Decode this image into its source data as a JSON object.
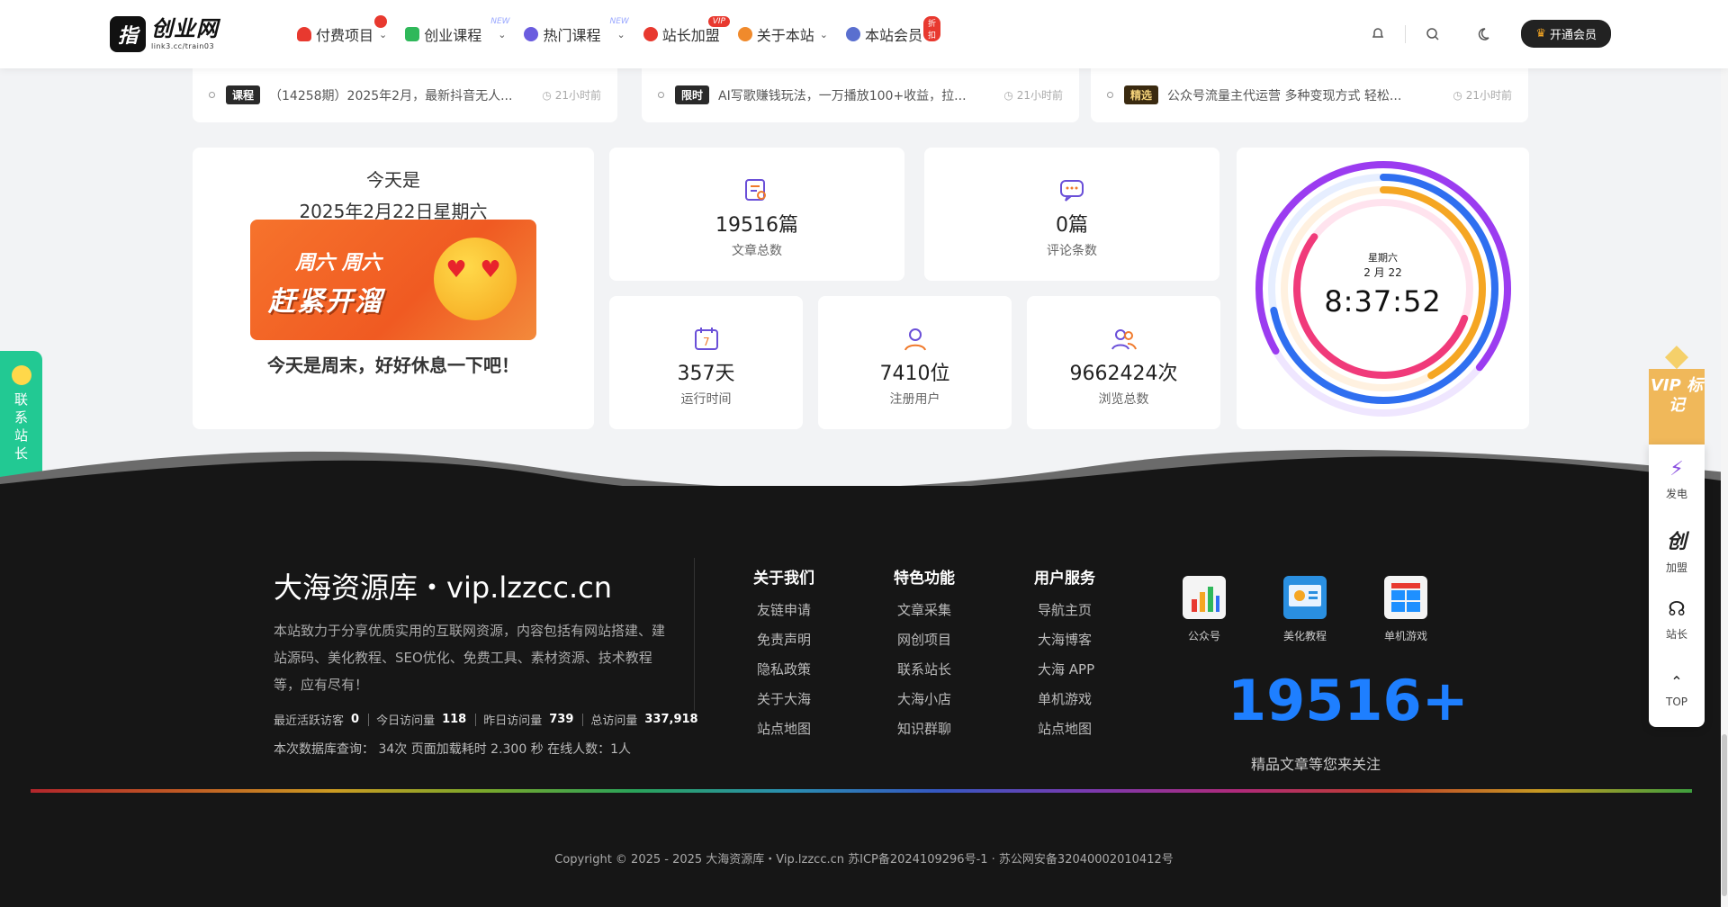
{
  "header": {
    "logo_mark": "指",
    "logo_title": "创业网",
    "logo_sub": "link3.cc/train03",
    "nav": [
      {
        "label": "付费项目",
        "badge": "",
        "color": "#e8392f"
      },
      {
        "label": "创业课程",
        "badge": "NEW",
        "color": "#2fb85a"
      },
      {
        "label": "热门课程",
        "badge": "NEW",
        "color": "#6a5cdf"
      },
      {
        "label": "站长加盟",
        "badge": "VIP",
        "color": "#e8392f"
      },
      {
        "label": "关于本站",
        "badge": "",
        "color": "#f08a2c"
      },
      {
        "label": "本站会员",
        "badge": "折扣",
        "color": "#5a6fcf"
      }
    ],
    "vip_button": "开通会员"
  },
  "lists": [
    {
      "tag": "课程",
      "title": "（14258期）2025年2月，最新抖音无人...",
      "time": "21小时前"
    },
    {
      "tag": "限时",
      "title": "AI写歌赚钱玩法，一万播放100+收益，拉...",
      "time": "21小时前"
    },
    {
      "tag": "精选",
      "title": "公众号流量主代运营  多种变现方式 轻松...",
      "time": "21小时前"
    }
  ],
  "today": {
    "label": "今天是",
    "date": "2025年2月22日星期六",
    "banner_line1": "周六 周六",
    "banner_line2": "赶紧开溜",
    "message": "今天是周末，好好休息一下吧！"
  },
  "stats": [
    {
      "value": "19516篇",
      "label": "文章总数"
    },
    {
      "value": "0篇",
      "label": "评论条数"
    },
    {
      "value": "357天",
      "label": "运行时间"
    },
    {
      "value": "7410位",
      "label": "注册用户"
    },
    {
      "value": "9662424次",
      "label": "浏览总数"
    }
  ],
  "clock": {
    "weekday": "星期六",
    "date": "2 月 22",
    "time": "8:37:52"
  },
  "contact_tab": "联系站长",
  "footer": {
    "brand": "大海资源库・vip.lzzcc.cn",
    "description": "本站致力于分享优质实用的互联网资源，内容包括有网站搭建、建站源码、美化教程、SEO优化、免费工具、素材资源、技术教程等，应有尽有！",
    "stats": [
      {
        "label": "最近活跃访客",
        "value": "0"
      },
      {
        "label": "今日访问量",
        "value": "118"
      },
      {
        "label": "昨日访问量",
        "value": "739"
      },
      {
        "label": "总访问量",
        "value": "337,918"
      }
    ],
    "query_info": "本次数据库查询： 34次 页面加载耗时 2.300 秒 在线人数：1人",
    "columns": [
      {
        "title": "关于我们",
        "links": [
          "友链申请",
          "免责声明",
          "隐私政策",
          "关于大海",
          "站点地图"
        ]
      },
      {
        "title": "特色功能",
        "links": [
          "文章采集",
          "网创项目",
          "联系站长",
          "大海小店",
          "知识群聊"
        ]
      },
      {
        "title": "用户服务",
        "links": [
          "导航主页",
          "大海博客",
          "大海 APP",
          "单机游戏",
          "站点地图"
        ]
      }
    ],
    "apps": [
      "公众号",
      "美化教程",
      "单机游戏"
    ],
    "big_number": "19516+",
    "follow_text": "精品文章等您来关注",
    "copyright": "Copyright © 2025 - 2025 大海资源库・Vip.lzzcc.cn 苏ICP备2024109296号-1 · 苏公网安备32040002010412号"
  },
  "sidebar": {
    "vip_text": "VIP 标记",
    "items": [
      "发电",
      "加盟",
      "站长",
      "TOP"
    ]
  }
}
